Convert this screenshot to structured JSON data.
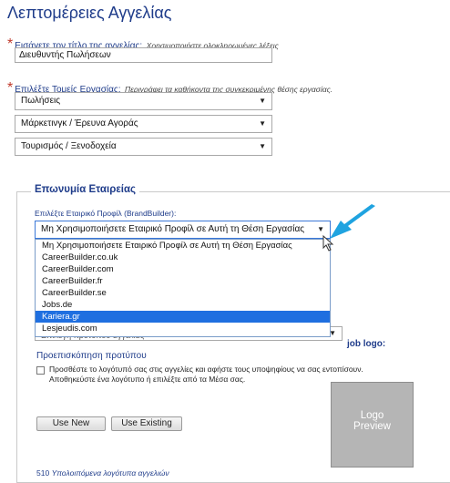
{
  "page_title": "Λεπτομέρειες Αγγελίας",
  "job_title": {
    "label": "Εισάγετε τον τίτλο της αγγελίας:",
    "hint": "Χρησιμοποιήστε ολοκληρωμένες λέξεις",
    "value": "Διευθυντής Πωλήσεων"
  },
  "work_areas": {
    "label": "Επιλέξτε Τομείς Εργασίας:",
    "hint": "Περιγράφει τα καθήκοντα της συγκεκριμένης θέσης εργασίας.",
    "selects": [
      "Πωλήσεις",
      "Μάρκετινγκ / Έρευνα Αγοράς",
      "Τουρισμός / Ξενοδοχεία"
    ]
  },
  "branding": {
    "legend": "Επωνυμία Εταιρείας",
    "profile_label": "Επιλέξτε Εταιρικό Προφίλ (BrandBuilder):",
    "selected_profile": "Μη Χρησιμοποιήσετε Εταιρικό Προφίλ σε Αυτή τη Θέση Εργασίας",
    "options": [
      "Μη Χρησιμοποιήσετε Εταιρικό Προφίλ σε Αυτή τη Θέση Εργασίας",
      "CareerBuilder.co.uk",
      "CareerBuilder.com",
      "CareerBuilder.fr",
      "CareerBuilder.se",
      "Jobs.de",
      "Kariera.gr",
      "Lesjeudis.com"
    ],
    "highlighted_option_index": 6,
    "partial_select_text": "Επιλογή πρότυπου αγγελίας",
    "job_logo_label": "job logo:",
    "preview_link": "Προεπισκόπηση προτύπου",
    "checkbox_text_line1": "Προσθέστε το λογότυπό σας στις αγγελίες και αφήστε τους υποψηφίους να σας εντοπίσουν.",
    "checkbox_text_line2": "Αποθηκεύστε ένα λογότυπο ή επιλέξτε από τα Μέσα σας.",
    "use_new": "Use New",
    "use_existing": "Use Existing",
    "logo_preview_line1": "Logo",
    "logo_preview_line2": "Preview",
    "remaining_count": "510",
    "remaining_label": "Υπολοιπόμενα λογότυπα αγγελιών"
  },
  "colors": {
    "heading": "#1f3c8a",
    "required": "#c0392b",
    "highlight": "#1f6fe0",
    "pointer_arrow": "#1fa3e0"
  },
  "icons": [
    "dropdown-arrow-icon",
    "pointer-arrow-icon",
    "mouse-cursor-icon"
  ]
}
